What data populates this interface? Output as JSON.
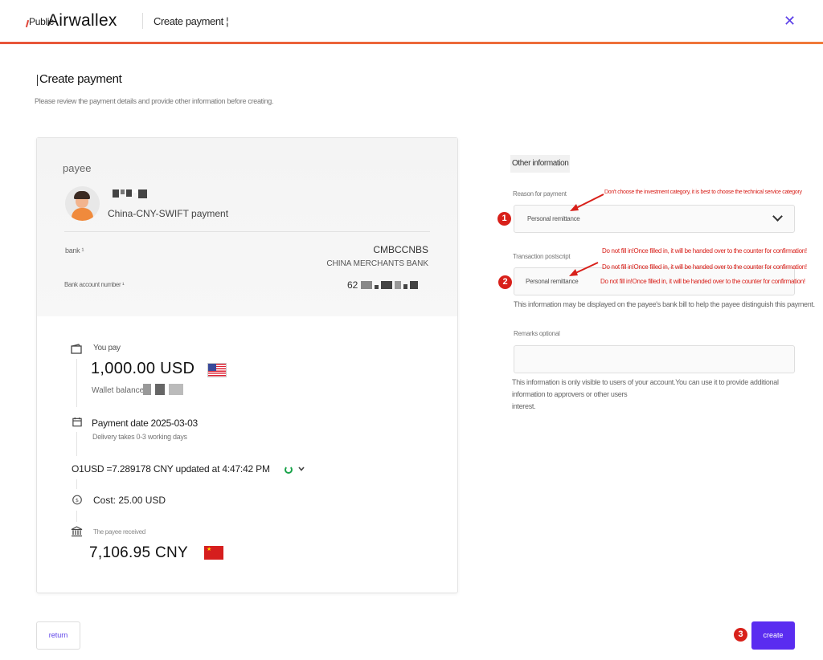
{
  "header": {
    "public_label": "Public",
    "brand": "Airwallex",
    "title": "Create payment ¦",
    "close_icon": "close-icon"
  },
  "page": {
    "title": "Create payment",
    "subtitle": "Please review the payment details and provide other information before creating."
  },
  "payee": {
    "label": "payee",
    "method": "China-CNY-SWIFT payment",
    "bank_label": "bank ¹",
    "bank_code": "CMBCCNBS",
    "bank_name": "CHINA MERCHANTS BANK",
    "account_label": "Bank account number ¹",
    "account_prefix": "62"
  },
  "summary": {
    "you_pay_label": "You pay",
    "you_pay_amount": "1,000.00 USD",
    "wallet_label": "Wallet balance:",
    "payment_date": "Payment date 2025-03-03",
    "delivery": "Delivery takes 0-3 working days",
    "rate": "O1USD =7.289178 CNY updated at 4:47:42 PM",
    "cost": "Cost: 25.00 USD",
    "received_label": "The payee received",
    "received_amount": "7,106.95 CNY"
  },
  "other": {
    "tag": "Other information",
    "reason_label": "Reason for payment",
    "reason_value": "Personal remittance",
    "postscript_label": "Transaction postscript",
    "postscript_value": "Personal remittance",
    "postscript_hint": "This information may be displayed on the payee's bank bill to help the payee distinguish this payment.",
    "remarks_label": "Remarks optional",
    "remarks_value": "",
    "remarks_hint_1": "This information is only visible to users of your account.You can use it to provide additional information to approvers or other users",
    "remarks_hint_2": "interest."
  },
  "annotations": {
    "reason_note": "Don't choose the investment category, it is best to choose the technical service category",
    "postscript_note": "Do not fill in!Once filled in, it will be handed over to the counter for confirmation!",
    "badge_1": "1",
    "badge_2": "2",
    "badge_3": "3",
    "color": "#d8201a"
  },
  "actions": {
    "return_label": "return",
    "create_label": "create"
  },
  "colors": {
    "accent": "#5a2cf0",
    "brand_stripe": "#e8553a"
  }
}
